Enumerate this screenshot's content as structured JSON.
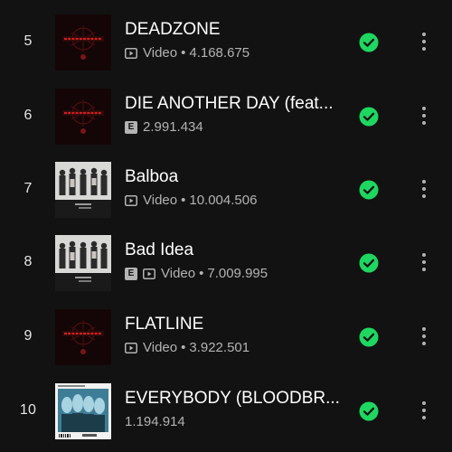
{
  "tracks": [
    {
      "number": "5",
      "title": "DEADZONE",
      "explicit": false,
      "video": true,
      "video_label": "Video",
      "separator": "•",
      "plays": "4.168.675",
      "thumb": "exit"
    },
    {
      "number": "6",
      "title": "DIE ANOTHER DAY (feat...",
      "explicit": true,
      "explicit_label": "E",
      "video": false,
      "plays": "2.991.434",
      "thumb": "exit"
    },
    {
      "number": "7",
      "title": "Balboa",
      "explicit": false,
      "video": true,
      "video_label": "Video",
      "separator": "•",
      "plays": "10.004.506",
      "thumb": "band"
    },
    {
      "number": "8",
      "title": "Bad Idea",
      "explicit": true,
      "explicit_label": "E",
      "video": true,
      "video_label": "Video",
      "separator": "•",
      "plays": "7.009.995",
      "thumb": "band"
    },
    {
      "number": "9",
      "title": "FLATLINE",
      "explicit": false,
      "video": true,
      "video_label": "Video",
      "separator": "•",
      "plays": "3.922.501",
      "thumb": "exit"
    },
    {
      "number": "10",
      "title": "EVERYBODY (BLOODBR...",
      "explicit": false,
      "video": false,
      "plays": "1.194.914",
      "thumb": "blue"
    }
  ],
  "artwork_text": "EXIT EMOTIONS",
  "icons": {
    "video": "video-play-icon",
    "saved": "saved-check-icon",
    "more": "more-options-icon"
  },
  "colors": {
    "background": "#121212",
    "accent": "#1ed760",
    "primary_text": "#ffffff",
    "secondary_text": "#b3b3b3"
  }
}
